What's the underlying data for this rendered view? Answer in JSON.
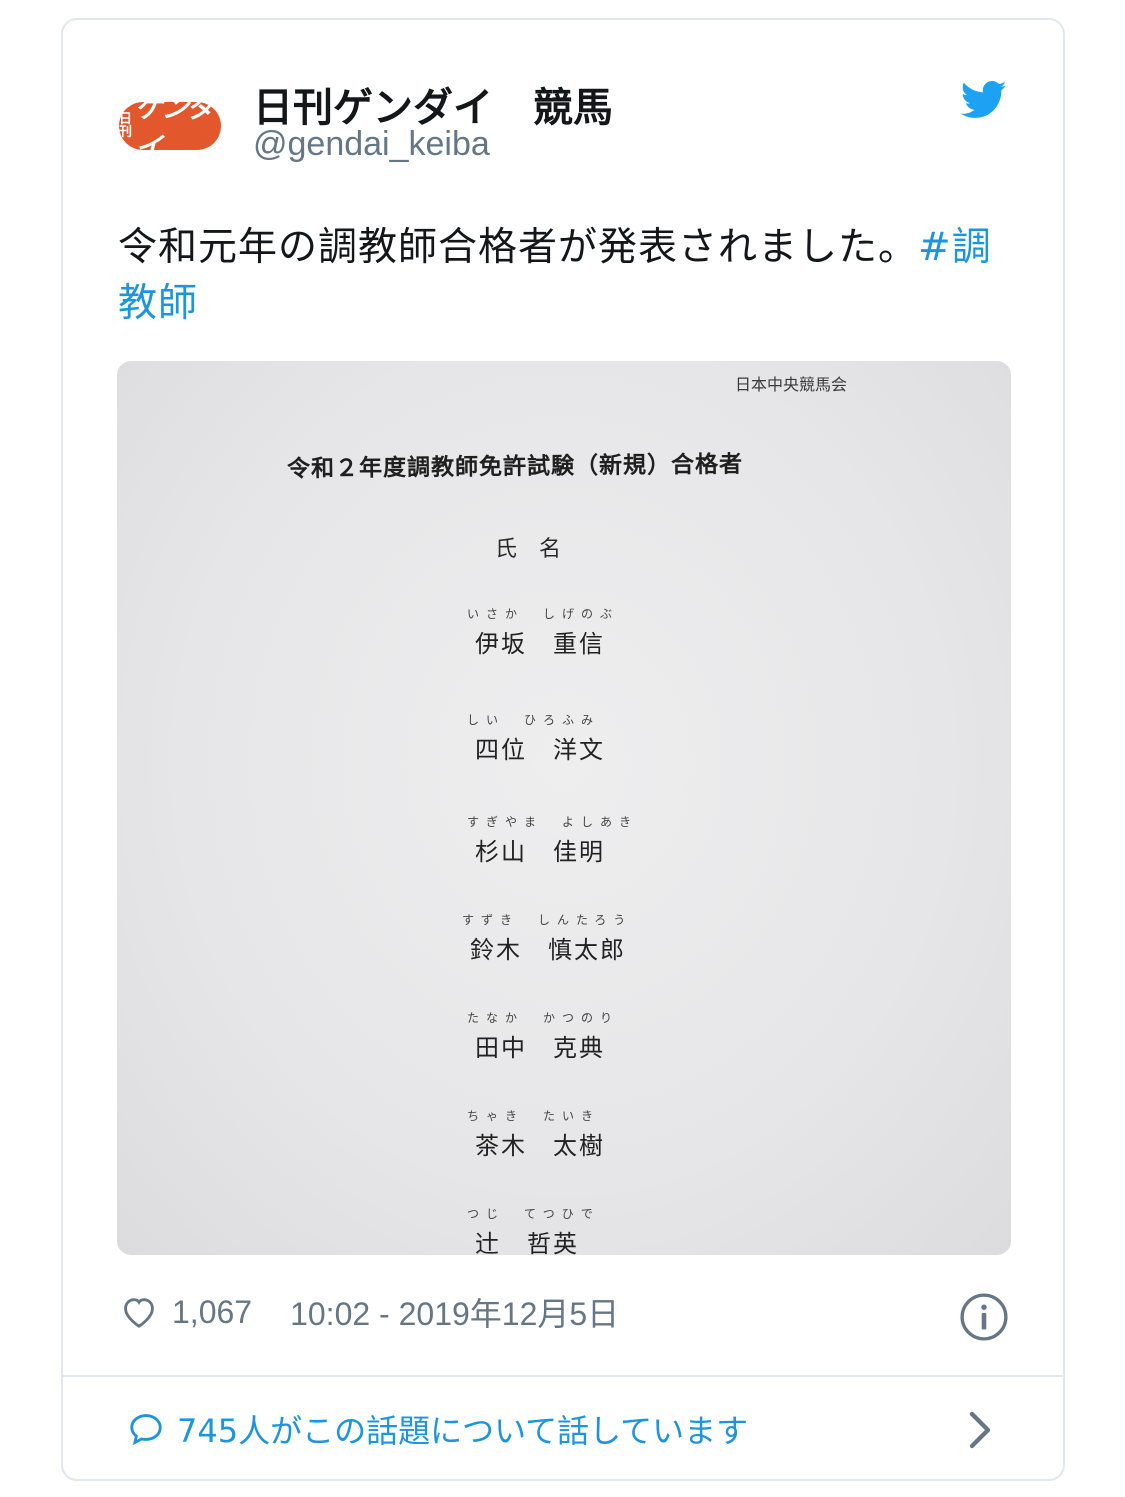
{
  "account": {
    "display_name": "日刊ゲンダイ　競馬",
    "handle": "@gendai_keiba",
    "avatar_mini": [
      "日",
      "刊"
    ],
    "avatar_logo": "ゲンダイ"
  },
  "tweet": {
    "text": "令和元年の調教師合格者が発表されました。",
    "hashtag": "#調教師"
  },
  "photo": {
    "organization": "日本中央競馬会",
    "title": "令和２年度調教師免許試験（新規）合格者",
    "column_header": "氏　名",
    "entries": [
      {
        "furigana": "いさか　しげのぶ",
        "name": "伊坂　重信"
      },
      {
        "furigana": "しい　ひろふみ",
        "name": "四位　洋文"
      },
      {
        "furigana": "すぎやま　よしあき",
        "name": "杉山　佳明"
      },
      {
        "furigana": "すずき　しんたろう",
        "name": "鈴木　慎太郎"
      },
      {
        "furigana": "たなか　かつのり",
        "name": "田中　克典"
      },
      {
        "furigana": "ちゃき　たいき",
        "name": "茶木　太樹"
      },
      {
        "furigana": "つじ　てつひで",
        "name": "辻　哲英"
      }
    ]
  },
  "footer": {
    "likes": "1,067",
    "timestamp": "10:02 - 2019年12月5日",
    "conversation": "745人がこの話題について話しています"
  },
  "icons": {
    "brand": "twitter-bird-icon",
    "like": "heart-icon",
    "info": "info-icon",
    "conversation": "speech-bubble-icon",
    "more": "chevron-right-icon"
  },
  "colors": {
    "twitter_blue": "#1b95e0",
    "avatar_orange": "#e2572b",
    "muted_text": "#657786",
    "border": "#e1e8ed"
  }
}
